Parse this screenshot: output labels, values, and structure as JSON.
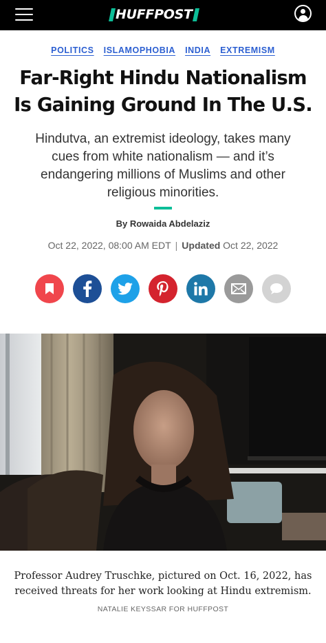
{
  "header": {
    "logo_text": "HUFFPOST",
    "menu_icon": "hamburger-menu-icon",
    "profile_icon": "user-profile-icon",
    "brand_color": "#0dbe98"
  },
  "tags": [
    "POLITICS",
    "ISLAMOPHOBIA",
    "INDIA",
    "EXTREMISM"
  ],
  "article": {
    "headline_line1": "Far-Right Hindu Nationalism",
    "headline_line2": "Is Gaining Ground In The U.S.",
    "dek": "Hindutva, an extremist ideology, takes many cues from white nationalism — and it’s endangering millions of Muslims and other religious minorities.",
    "byline": "By Rowaida Abdelaziz",
    "published": "Oct 22, 2022, 08:00 AM EDT",
    "updated_label": "Updated",
    "updated": "Oct 22, 2022",
    "date_separator": "|"
  },
  "share_buttons": [
    {
      "name": "bookmark",
      "icon": "bookmark-icon",
      "color": "#f0464c"
    },
    {
      "name": "facebook",
      "icon": "facebook-icon",
      "color": "#1d4f96"
    },
    {
      "name": "twitter",
      "icon": "twitter-icon",
      "color": "#1ea1e8"
    },
    {
      "name": "pinterest",
      "icon": "pinterest-icon",
      "color": "#d4232e"
    },
    {
      "name": "linkedin",
      "icon": "linkedin-icon",
      "color": "#1e78a8"
    },
    {
      "name": "email",
      "icon": "email-icon",
      "color": "#9a9a9a"
    },
    {
      "name": "comments",
      "icon": "comment-bubble-icon",
      "color": "#d3d3d3"
    }
  ],
  "photo": {
    "caption": "Professor Audrey Truschke, pictured on Oct. 16, 2022, has received threats for her work looking at Hindu extremism.",
    "credit": "NATALIE KEYSSAR FOR HUFFPOST"
  }
}
